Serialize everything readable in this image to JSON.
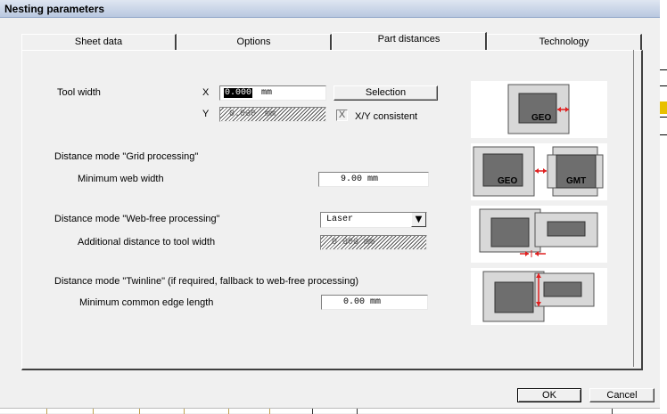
{
  "window": {
    "title": "Nesting parameters"
  },
  "tabs": [
    {
      "label": "Sheet data",
      "active": false
    },
    {
      "label": "Options",
      "active": false
    },
    {
      "label": "Part distances",
      "active": true
    },
    {
      "label": "Technology",
      "active": false
    }
  ],
  "tool_width": {
    "label": "Tool width",
    "x_label": "X",
    "x_value": "0.000",
    "x_unit": "mm",
    "y_label": "Y",
    "y_value": "0.000",
    "y_unit": "mm",
    "selection_button": "Selection",
    "xy_consistent_label": "X/Y consistent",
    "xy_consistent_checked": true,
    "xy_check_mark": "X"
  },
  "grid_processing": {
    "heading": "Distance mode \"Grid processing\"",
    "min_web_width_label": "Minimum web width",
    "min_web_width_value": "9.00 mm"
  },
  "web_free": {
    "heading": "Distance mode \"Web-free  processing\"",
    "mode_value": "Laser",
    "additional_distance_label": "Additional distance to tool width",
    "additional_distance_value": "0.000 mm"
  },
  "twinline": {
    "heading": "Distance mode \"Twinline\" (if required, fallback to web-free processing)",
    "min_common_edge_label": "Minimum common edge length",
    "min_common_edge_value": "0.00 mm"
  },
  "illustrations": {
    "geo_label": "GEO",
    "gmt_label": "GMT"
  },
  "buttons": {
    "ok": "OK",
    "cancel": "Cancel"
  },
  "colors": {
    "accent_red": "#e02020",
    "part_dark": "#6e6e6e",
    "part_light": "#d8d8d8"
  }
}
